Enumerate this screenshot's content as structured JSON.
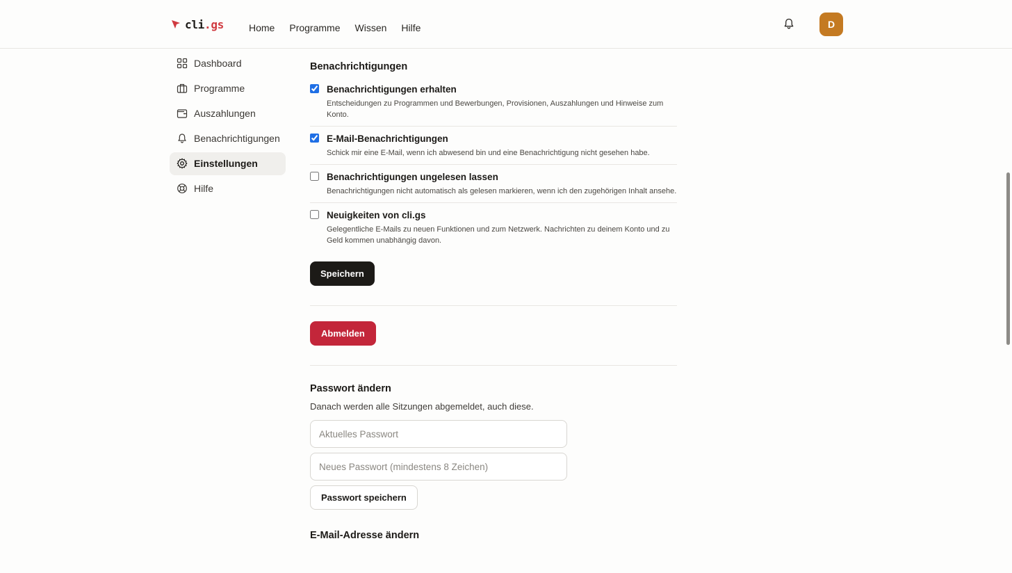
{
  "header": {
    "logo_main": "cli",
    "logo_tld": ".gs",
    "nav": [
      "Home",
      "Programme",
      "Wissen",
      "Hilfe"
    ],
    "avatar_initial": "D",
    "avatar_color": "#c47a22"
  },
  "sidebar": {
    "items": [
      {
        "label": "Dashboard",
        "icon": "dashboard-grid-icon"
      },
      {
        "label": "Programme",
        "icon": "briefcase-icon"
      },
      {
        "label": "Auszahlungen",
        "icon": "wallet-icon"
      },
      {
        "label": "Benachrichtigungen",
        "icon": "bell-icon"
      },
      {
        "label": "Einstellungen",
        "icon": "gear-icon",
        "active": true
      },
      {
        "label": "Hilfe",
        "icon": "lifebuoy-icon"
      }
    ]
  },
  "notifications": {
    "title": "Benachrichtigungen",
    "options": [
      {
        "title": "Benachrichtigungen erhalten",
        "description": "Entscheidungen zu Programmen und Bewerbungen, Provisionen, Auszahlungen und Hinweise zum Konto.",
        "checked": true
      },
      {
        "title": "E-Mail-Benachrichtigungen",
        "description": "Schick mir eine E-Mail, wenn ich abwesend bin und eine Benachrichtigung nicht gesehen habe.",
        "checked": true
      },
      {
        "title": "Benachrichtigungen ungelesen lassen",
        "description": "Benachrichtigungen nicht automatisch als gelesen markieren, wenn ich den zugehörigen Inhalt ansehe.",
        "checked": false
      },
      {
        "title": "Neuigkeiten von cli.gs",
        "description": "Gelegentliche E-Mails zu neuen Funktionen und zum Netzwerk. Nachrichten zu deinem Konto und zu Geld kommen unabhängig davon.",
        "checked": false
      }
    ],
    "save_label": "Speichern"
  },
  "logout": {
    "label": "Abmelden",
    "color": "#c3263a"
  },
  "password": {
    "title": "Passwort ändern",
    "subtitle": "Danach werden alle Sitzungen abgemeldet, auch diese.",
    "current_placeholder": "Aktuelles Passwort",
    "new_placeholder": "Neues Passwort (mindestens 8 Zeichen)",
    "save_label": "Passwort speichern"
  },
  "email": {
    "title": "E-Mail-Adresse ändern"
  },
  "accent_color": "#1f6fe5"
}
